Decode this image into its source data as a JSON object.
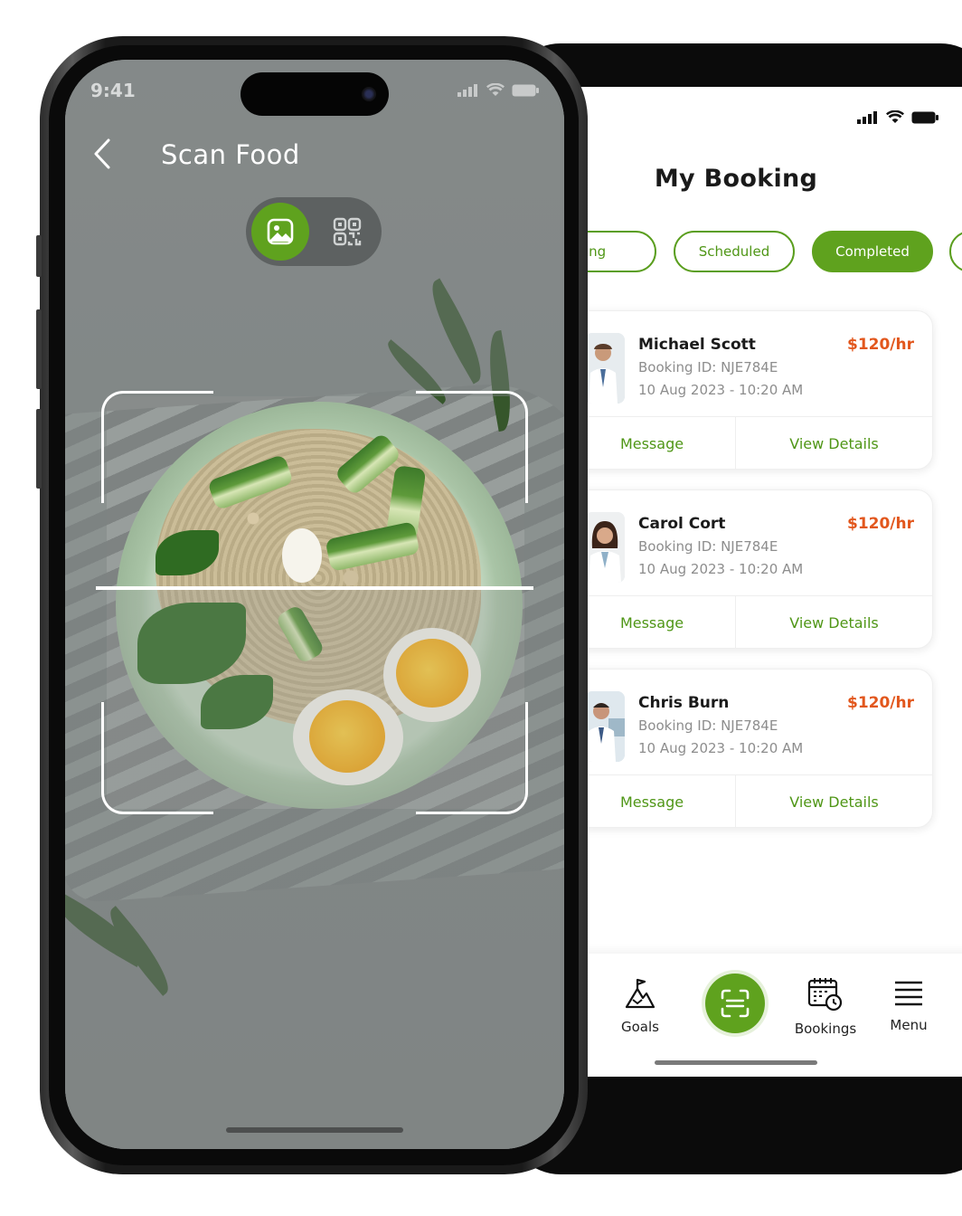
{
  "scan_screen": {
    "time": "9:41",
    "title": "Scan Food",
    "mode_toggle": {
      "active": "image-icon",
      "inactive": "qr-code-icon"
    }
  },
  "booking_screen": {
    "title": "My Booking",
    "filters": [
      "nding",
      "Scheduled",
      "Completed"
    ],
    "active_filter": "Completed",
    "bookings": [
      {
        "name": "Michael Scott",
        "price": "$120/hr",
        "booking_id": "Booking ID: NJE784E",
        "date": "10 Aug 2023 - 10:20 AM",
        "message_label": "Message",
        "details_label": "View Details"
      },
      {
        "name": "Carol Cort",
        "price": "$120/hr",
        "booking_id": "Booking ID: NJE784E",
        "date": "10 Aug 2023 - 10:20 AM",
        "message_label": "Message",
        "details_label": "View Details"
      },
      {
        "name": "Chris Burn",
        "price": "$120/hr",
        "booking_id": "Booking ID: NJE784E",
        "date": "10 Aug 2023 - 10:20 AM",
        "message_label": "Message",
        "details_label": "View Details"
      }
    ],
    "tabbar": {
      "goals": "Goals",
      "bookings": "Bookings",
      "menu": "Menu"
    }
  },
  "colors": {
    "accent": "#5fa21e",
    "price": "#e2571d"
  }
}
